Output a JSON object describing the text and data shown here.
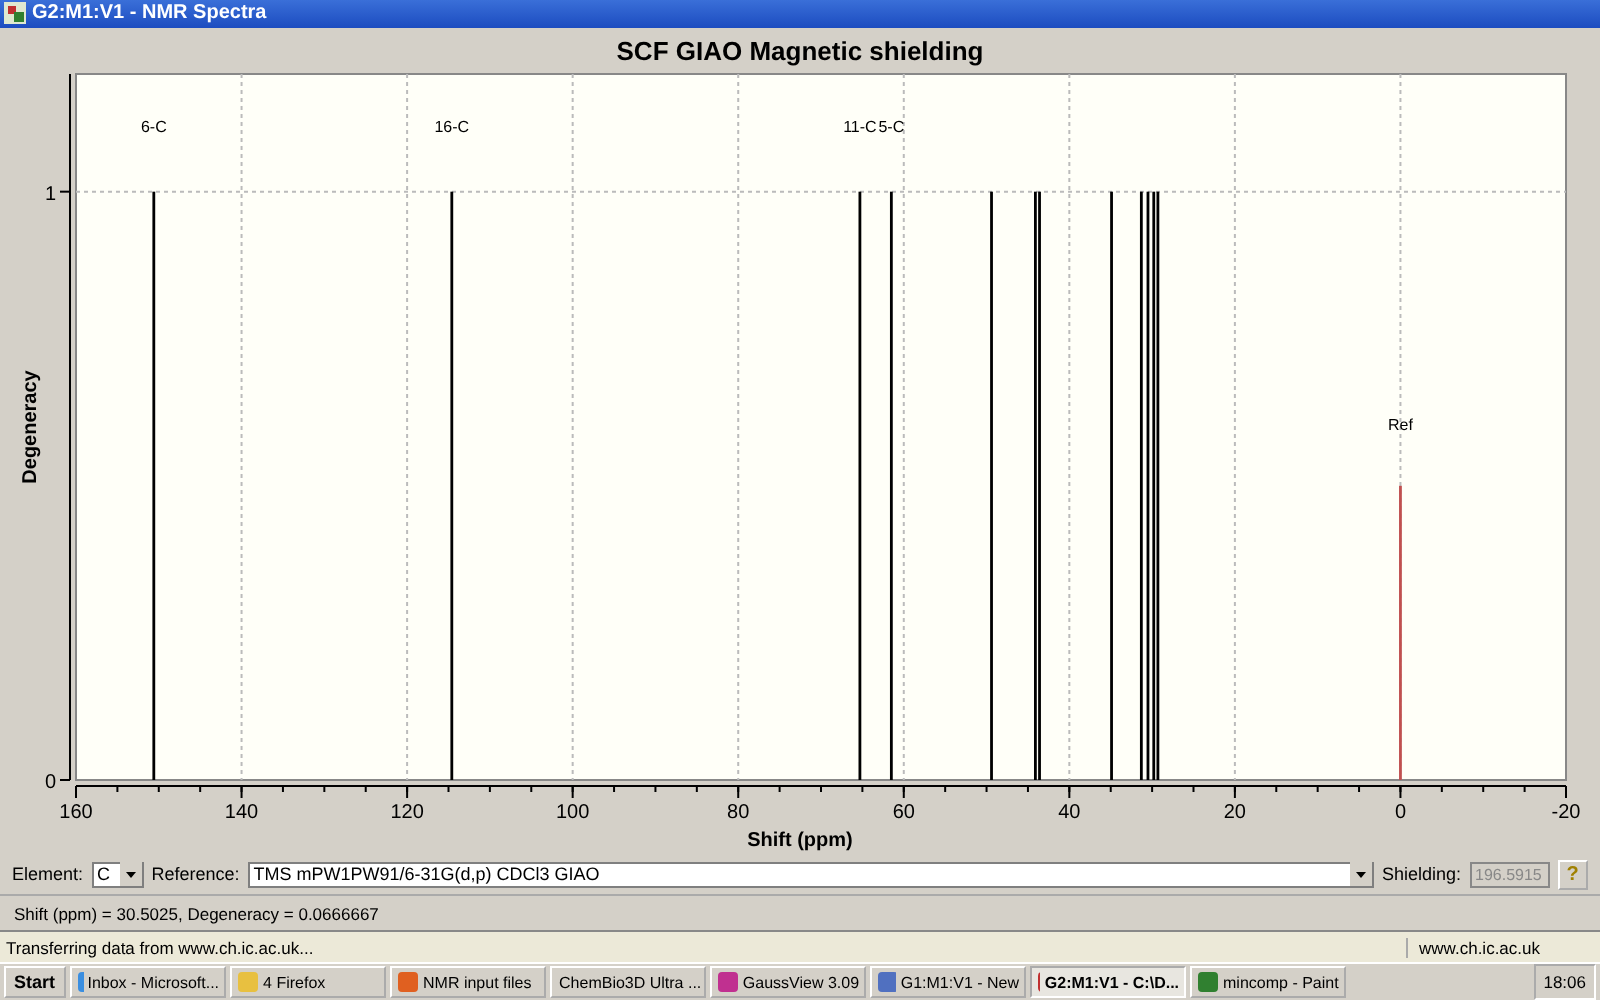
{
  "window": {
    "title": "G2:M1:V1 - NMR Spectra"
  },
  "spectrum": {
    "chart_data": {
      "type": "bar",
      "title": "SCF GIAO Magnetic shielding",
      "xlabel": "Shift (ppm)",
      "ylabel": "Degeneracy",
      "x": [
        150.6,
        114.6,
        65.3,
        61.5,
        49.4,
        44.1,
        43.6,
        34.9,
        31.3,
        30.5,
        29.8,
        29.3,
        0
      ],
      "series": [
        {
          "color": "#000000",
          "values": [
            1,
            1,
            1,
            1,
            1,
            1,
            1,
            1,
            1,
            1,
            1,
            1,
            null
          ]
        },
        {
          "color": "#c05050",
          "values": [
            null,
            null,
            null,
            null,
            null,
            null,
            null,
            null,
            null,
            null,
            null,
            null,
            0.5
          ]
        }
      ],
      "xlim": [
        160,
        -20
      ],
      "ylim": [
        0,
        1.2
      ],
      "xticks": [
        160,
        140,
        120,
        100,
        80,
        60,
        40,
        20,
        0,
        -20
      ],
      "yticks": [
        0,
        1
      ],
      "grid": true,
      "annotations": [
        "6-C",
        "16-C",
        "11-C",
        "5-C",
        "Ref"
      ]
    }
  },
  "controls": {
    "element_label": "Element:",
    "element": "C",
    "reference_label": "Reference:",
    "reference": "TMS mPW1PW91/6-31G(d,p) CDCl3 GIAO",
    "shielding_label": "Shielding:",
    "shielding": "196.5915",
    "help": "?"
  },
  "readout": "Shift (ppm) = 30.5025,  Degeneracy = 0.0666667",
  "browser_status": {
    "text": "Transferring data from www.ch.ic.ac.uk...",
    "zone": "www.ch.ic.ac.uk"
  },
  "taskbar": {
    "start": "Start",
    "items": [
      {
        "label": "Inbox - Microsoft...",
        "selected": false
      },
      {
        "label": "4 Firefox",
        "selected": false
      },
      {
        "label": "NMR input files",
        "selected": false
      },
      {
        "label": "ChemBio3D Ultra ...",
        "selected": false
      },
      {
        "label": "GaussView 3.09",
        "selected": false
      },
      {
        "label": "G1:M1:V1 - New",
        "selected": false
      },
      {
        "label": "G2:M1:V1 - C:\\D...",
        "selected": true
      },
      {
        "label": "mincomp - Paint",
        "selected": false
      }
    ],
    "clock": "18:06"
  }
}
